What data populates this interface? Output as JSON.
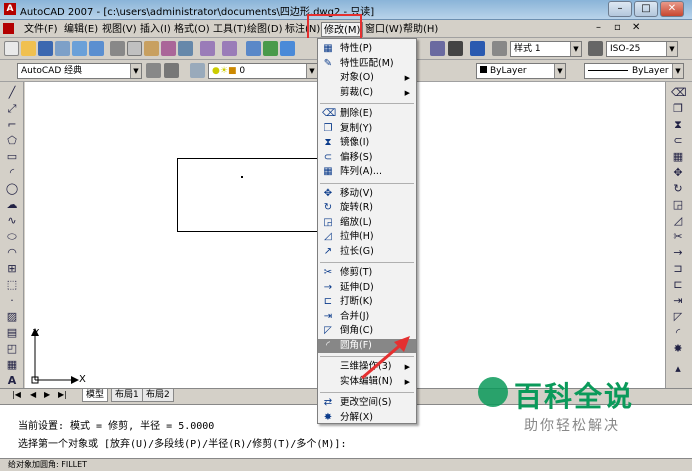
{
  "window": {
    "title": "AutoCAD 2007 - [c:\\users\\administrator\\documents\\四边形.dwg2 - 只读]",
    "min_label": "–",
    "max_label": "□",
    "close_label": "✕"
  },
  "menubar": {
    "items": [
      {
        "label": "文件(F)"
      },
      {
        "label": "编辑(E)"
      },
      {
        "label": "视图(V)"
      },
      {
        "label": "插入(I)"
      },
      {
        "label": "格式(O)"
      },
      {
        "label": "工具(T)"
      },
      {
        "label": "绘图(D)"
      },
      {
        "label": "标注(N)"
      },
      {
        "label": "修改(M)"
      },
      {
        "label": "窗口(W)"
      },
      {
        "label": "帮助(H)"
      }
    ],
    "active_index": 8
  },
  "toolbar1": {
    "text_style": "样式 1",
    "dim_style": "ISO-25"
  },
  "toolbar2": {
    "workspace": "AutoCAD 经典",
    "layer": "0",
    "color": "ByLayer",
    "linetype": "ByLayer"
  },
  "canvas": {
    "ucs_y": "Y",
    "ucs_x": "X"
  },
  "tabs": {
    "nav": [
      "|◀",
      "◀",
      "▶",
      "▶|"
    ],
    "items": [
      "模型",
      "布局1",
      "布局2"
    ]
  },
  "command": {
    "line1": "当前设置: 模式 = 修剪, 半径 = 5.0000",
    "line2": "选择第一个对象或 [放弃(U)/多段线(P)/半径(R)/修剪(T)/多个(M)]:"
  },
  "status": {
    "text": "给对象加圆角:  FILLET"
  },
  "dropdown": {
    "items": [
      {
        "label": "特性(P)",
        "icon": "properties-icon",
        "glyph": "▦"
      },
      {
        "label": "特性匹配(M)",
        "icon": "match-properties-icon",
        "glyph": "✎"
      },
      {
        "label": "对象(O)",
        "submenu": true
      },
      {
        "label": "剪裁(C)",
        "submenu": true
      },
      {
        "label": "删除(E)",
        "icon": "erase-icon",
        "glyph": "⌫"
      },
      {
        "label": "复制(Y)",
        "icon": "copy-icon",
        "glyph": "❐"
      },
      {
        "label": "镜像(I)",
        "icon": "mirror-icon",
        "glyph": "⧗"
      },
      {
        "label": "偏移(S)",
        "icon": "offset-icon",
        "glyph": "⊂"
      },
      {
        "label": "阵列(A)...",
        "icon": "array-icon",
        "glyph": "▦"
      },
      {
        "label": "移动(V)",
        "icon": "move-icon",
        "glyph": "✥"
      },
      {
        "label": "旋转(R)",
        "icon": "rotate-icon",
        "glyph": "↻"
      },
      {
        "label": "缩放(L)",
        "icon": "scale-icon",
        "glyph": "◲"
      },
      {
        "label": "拉伸(H)",
        "icon": "stretch-icon",
        "glyph": "◿"
      },
      {
        "label": "拉长(G)",
        "icon": "lengthen-icon",
        "glyph": "↗"
      },
      {
        "label": "修剪(T)",
        "icon": "trim-icon",
        "glyph": "✂"
      },
      {
        "label": "延伸(D)",
        "icon": "extend-icon",
        "glyph": "→"
      },
      {
        "label": "打断(K)",
        "icon": "break-icon",
        "glyph": "⊏"
      },
      {
        "label": "合并(J)",
        "icon": "join-icon",
        "glyph": "⇥"
      },
      {
        "label": "倒角(C)",
        "icon": "chamfer-icon",
        "glyph": "◸"
      },
      {
        "label": "圆角(F)",
        "icon": "fillet-icon",
        "glyph": "◜"
      },
      {
        "label": "三维操作(3)",
        "submenu": true
      },
      {
        "label": "实体编辑(N)",
        "submenu": true
      },
      {
        "label": "更改空间(S)",
        "icon": "change-space-icon",
        "glyph": "⇄"
      },
      {
        "label": "分解(X)",
        "icon": "explode-icon",
        "glyph": "✸"
      }
    ],
    "selected_index": 19
  },
  "watermark": {
    "main": "百科全说",
    "sub": "助你轻松解决"
  },
  "colors": {
    "accent": "#e53030",
    "watermark": "#0a9a5a",
    "selected": "#878787"
  }
}
